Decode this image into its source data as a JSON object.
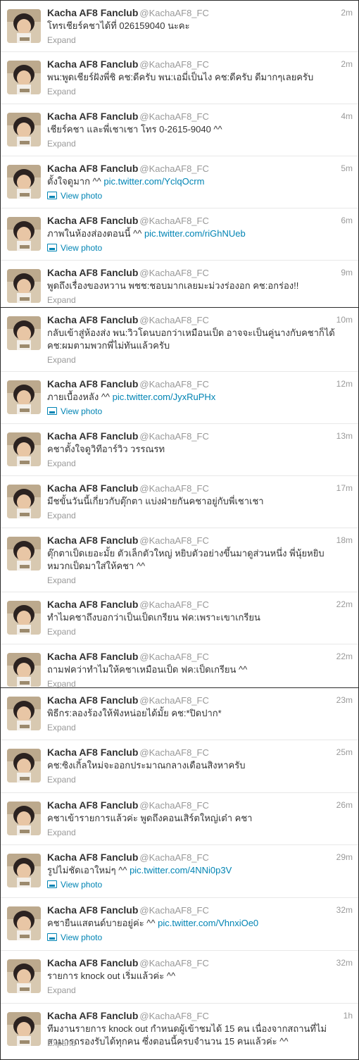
{
  "user": {
    "name": "Kacha AF8 Fanclub",
    "handle": "@KachaAF8_FC"
  },
  "labels": {
    "expand": "Expand",
    "view_photo": "View photo"
  },
  "colors": {
    "link": "#0084b4",
    "meta": "#999999",
    "text": "#333333"
  },
  "tweets": [
    {
      "time": "2m",
      "text": "โทรเชียร์คชาได้ที่ 026159040 นะคะ",
      "link": "",
      "action": "Expand"
    },
    {
      "time": "2m",
      "text": "พน:พูดเชียร์ฝังพี่ชิ คช:ดีครับ พน:เอมี่เป็นไง คช:ดีครับ ดีมากๆเลยครับ",
      "link": "",
      "action": "Expand"
    },
    {
      "time": "4m",
      "text": "เชียร์คชา และพี่เชาเชา โทร 0-2615-9040 ^^",
      "link": "",
      "action": "Expand"
    },
    {
      "time": "5m",
      "text": "ตั้งใจดูมาก ^^ ",
      "link": "pic.twitter.com/YclqOcrm",
      "action": "View photo"
    },
    {
      "time": "6m",
      "text": "ภาพในห้องส่องตอนนี้ ^^ ",
      "link": "pic.twitter.com/riGhNUeb",
      "action": "View photo"
    },
    {
      "time": "9m",
      "text": "พูดถึงเรื่องของหวาน พชช:ชอบมากเลยมะม่วงร่องอก คช:อกร่อง!!",
      "link": "",
      "action": "Expand"
    },
    {
      "time": "10m",
      "text": "กลับเข้าสู่ห้องส่ง พน:วิวโดนบอกว่าเหมือนเป็ด อาจจะเป็นคู่นางกับคชาก็ได้ คช:ผมตามพวกพี่ไม่ทันแล้วครับ",
      "link": "",
      "action": "Expand"
    },
    {
      "time": "12m",
      "text": "ภายเบื้องหลัง ^^ ",
      "link": "pic.twitter.com/JyxRuPHx",
      "action": "View photo"
    },
    {
      "time": "13m",
      "text": "คชาตั้งใจดูวิทีอาร์วิว วรรณรท",
      "link": "",
      "action": "Expand"
    },
    {
      "time": "17m",
      "text": "มีชขั้นวันนี้เกี่ยวกับตุ๊กตา แบ่งฝ่ายกันคชาอยู่กับพี่เชาเชา",
      "link": "",
      "action": "Expand"
    },
    {
      "time": "18m",
      "text": "ตุ๊กตาเป็ดเยอะมั้ย ตัวเล็กตัวใหญ่ หยิบตัวอย่างขึ้นมาดูส่วนหนึ่ง พี่นุ้ยหยิบหมวกเป็ดมาใส่ให้คชา ^^",
      "link": "",
      "action": "Expand"
    },
    {
      "time": "22m",
      "text": "ทำไมคชาถึงบอกว่าเป็นเป็ดเกรียน ฟค:เพราะเขาเกรียน",
      "link": "",
      "action": "Expand"
    },
    {
      "time": "22m",
      "text": "ถามฟคว่าทำไมให้คชาเหมือนเป็ด ฟค:เป็ดเกรียน ^^",
      "link": "",
      "action": "Expand"
    },
    {
      "time": "23m",
      "text": "พิธีกร:ลองร้องให้ฟังหน่อยได้มั้ย คช:*ปิดปาก*",
      "link": "",
      "action": "Expand"
    },
    {
      "time": "25m",
      "text": "คช:ซิงเกิ้ลใหม่จะออกประมาณกลางเดือนสิงหาครับ",
      "link": "",
      "action": "Expand"
    },
    {
      "time": "26m",
      "text": "คชาเข้ารายการแล้วค่ะ พูดถึงคอนเสิร์ตใหญ่เต๋า คชา",
      "link": "",
      "action": "Expand"
    },
    {
      "time": "29m",
      "text": "รูปไม่ชัดเอาใหม่ๆ ^^ ",
      "link": "pic.twitter.com/4NNi0p3V",
      "action": "View photo"
    },
    {
      "time": "32m",
      "text": "คชายืนแสตนด์บายอยู่ค่ะ ^^ ",
      "link": "pic.twitter.com/VhnxiOe0",
      "action": "View photo"
    },
    {
      "time": "32m",
      "text": "รายการ knock out เริ่มแล้วค่ะ ^^",
      "link": "",
      "action": "Expand"
    },
    {
      "time": "1h",
      "text": "ทีมงานรายการ knock out กำหนดผู้เข้าชมได้ 15 คน เนื่องจากสถานที่ไม่สามารถรองรับได้ทุกคน ซึ่งตอนนี้ครบจำนวน 15 คนแล้วค่ะ ^^",
      "link": "",
      "action": "Expand"
    }
  ]
}
